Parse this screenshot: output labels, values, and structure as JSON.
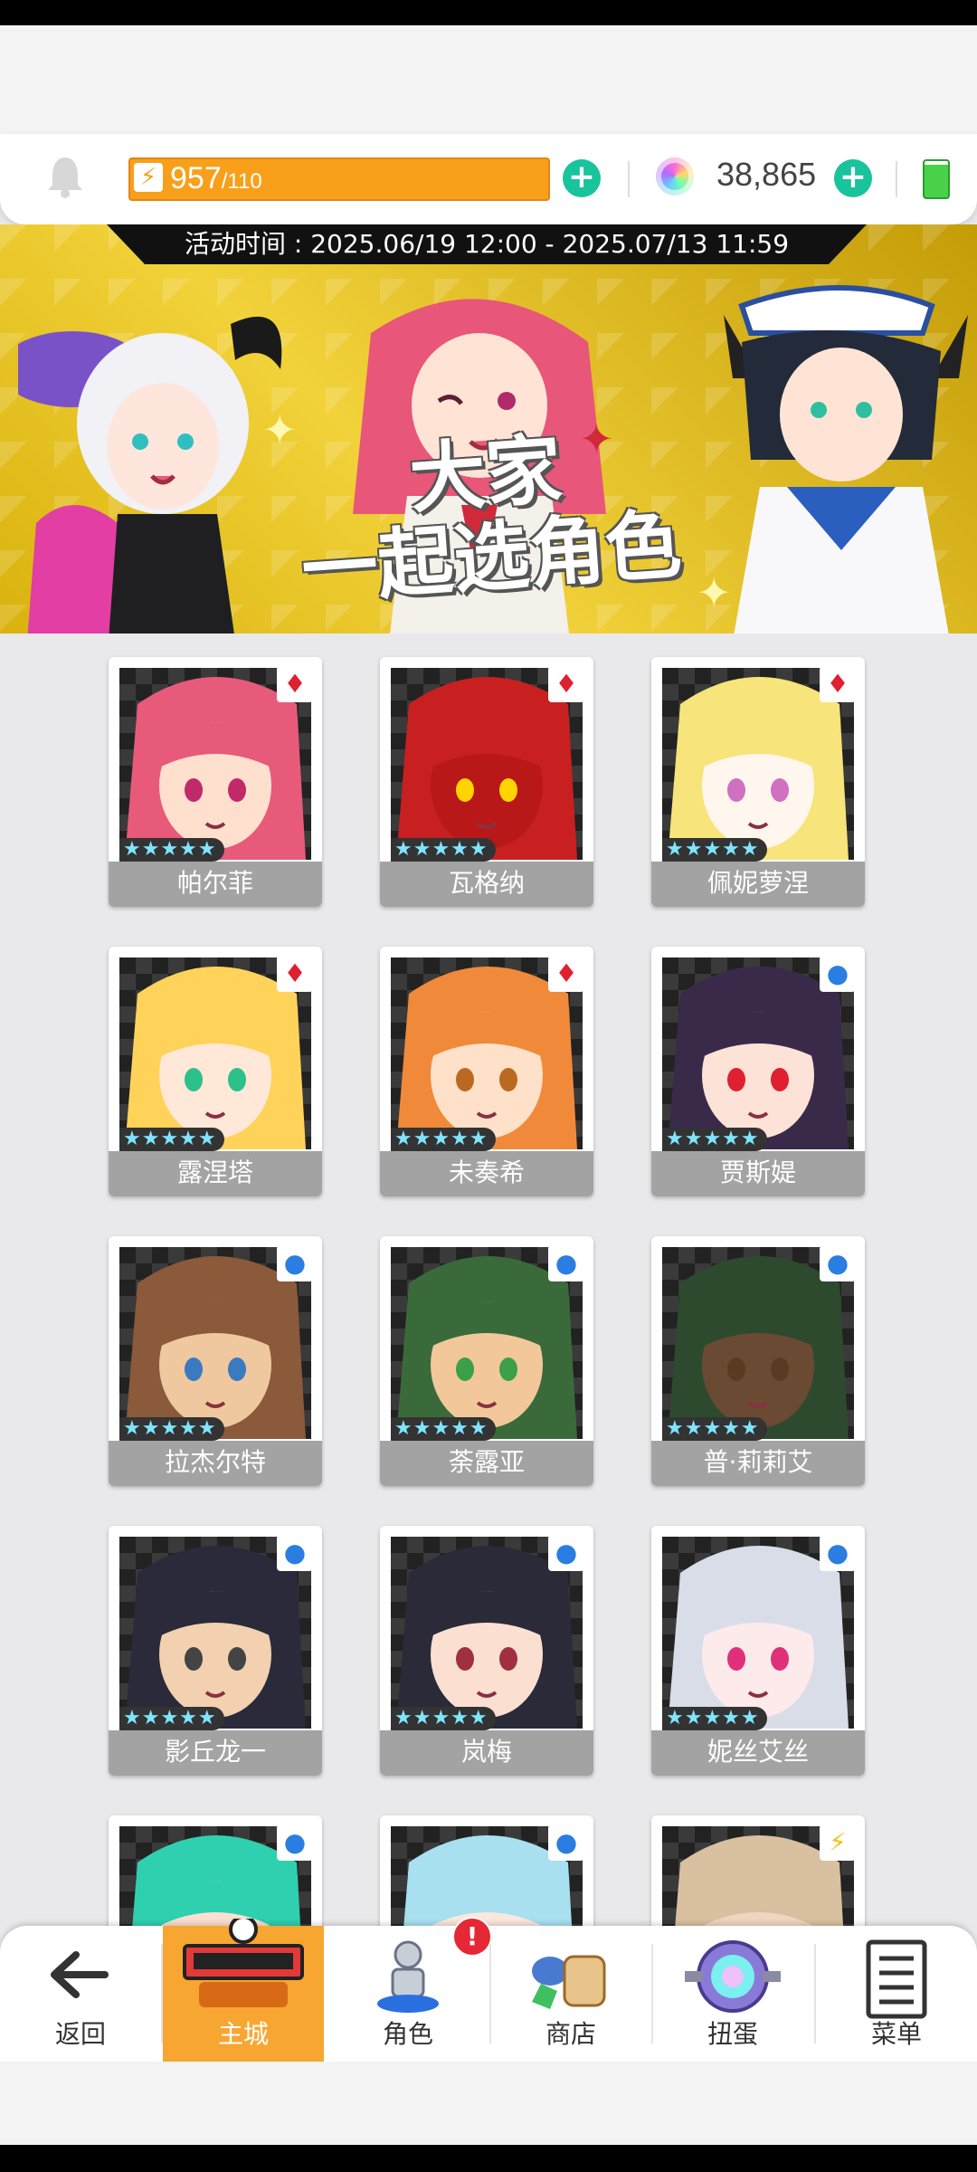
{
  "header": {
    "energy_current": "957",
    "energy_max": "/110",
    "gems": "38,865",
    "battery_level": 0.9
  },
  "banner": {
    "event_time": "活动时间 : 2025.06/19 12:00 - 2025.07/13 11:59",
    "title_line1": "大家",
    "title_line2": "一起选角色"
  },
  "characters": [
    {
      "name": "帕尔菲",
      "stars": "★★★★★",
      "badge": "red-diamond",
      "hair": "#e85a7a",
      "skin": "#ffe0cf",
      "eye": "#c02a6a"
    },
    {
      "name": "瓦格纳",
      "stars": "★★★★★",
      "badge": "red-diamond",
      "hair": "#c82020",
      "skin": "#b81818",
      "eye": "#ffd400"
    },
    {
      "name": "佩妮萝涅",
      "stars": "★★★★★",
      "badge": "red-diamond",
      "hair": "#f7e47a",
      "skin": "#fff6ee",
      "eye": "#d070c0"
    },
    {
      "name": "露涅塔",
      "stars": "★★★★★",
      "badge": "red-diamond",
      "hair": "#ffd35a",
      "skin": "#ffe8d8",
      "eye": "#2cc08a"
    },
    {
      "name": "未奏希",
      "stars": "★★★★★",
      "badge": "red-diamond",
      "hair": "#f08a3a",
      "skin": "#ffe0c8",
      "eye": "#b96a20"
    },
    {
      "name": "贾斯媞",
      "stars": "★★★★★",
      "badge": "blue-circle",
      "hair": "#3a2a4a",
      "skin": "#fde2d8",
      "eye": "#e02030"
    },
    {
      "name": "拉杰尔特",
      "stars": "★★★★★",
      "badge": "blue-circle",
      "hair": "#8a5a3a",
      "skin": "#f0c8a0",
      "eye": "#3a7ac0"
    },
    {
      "name": "荼露亚",
      "stars": "★★★★★",
      "badge": "blue-circle",
      "hair": "#3a6a3a",
      "skin": "#f2c89a",
      "eye": "#3aa04a"
    },
    {
      "name": "普·莉莉艾",
      "stars": "★★★★★",
      "badge": "blue-circle",
      "hair": "#2e4a2e",
      "skin": "#6a4a32",
      "eye": "#5a3a20"
    },
    {
      "name": "影丘龙一",
      "stars": "★★★★★",
      "badge": "blue-circle",
      "hair": "#2a2a3a",
      "skin": "#f2d0b0",
      "eye": "#444444"
    },
    {
      "name": "岚梅",
      "stars": "★★★★★",
      "badge": "blue-circle",
      "hair": "#2a2a38",
      "skin": "#fbe0d2",
      "eye": "#a03040"
    },
    {
      "name": "妮丝艾丝",
      "stars": "★★★★★",
      "badge": "blue-circle",
      "hair": "#d8dde8",
      "skin": "#fdeaea",
      "eye": "#e0307a"
    },
    {
      "name": "",
      "stars": "",
      "badge": "blue-circle",
      "hair": "#2fd0b0",
      "skin": "#fbe0d2",
      "eye": "#444444"
    },
    {
      "name": "",
      "stars": "",
      "badge": "blue-circle",
      "hair": "#a8e0f0",
      "skin": "#fbe8dd",
      "eye": "#444444"
    },
    {
      "name": "",
      "stars": "",
      "badge": "gold-bolt",
      "hair": "#d8c0a0",
      "skin": "#f0d6c0",
      "eye": "#444444"
    }
  ],
  "badge_symbols": {
    "red-diamond": "♦",
    "blue-circle": "●",
    "gold-bolt": "⚡"
  },
  "nav": {
    "back": "返回",
    "main_city": "主城",
    "characters": "角色",
    "shop": "商店",
    "gacha": "扭蛋",
    "menu": "菜单",
    "alert": "!"
  },
  "colors": {
    "accent_orange": "#f8a019",
    "plus_green": "#19c39b",
    "nav_active": "#f7a632"
  }
}
